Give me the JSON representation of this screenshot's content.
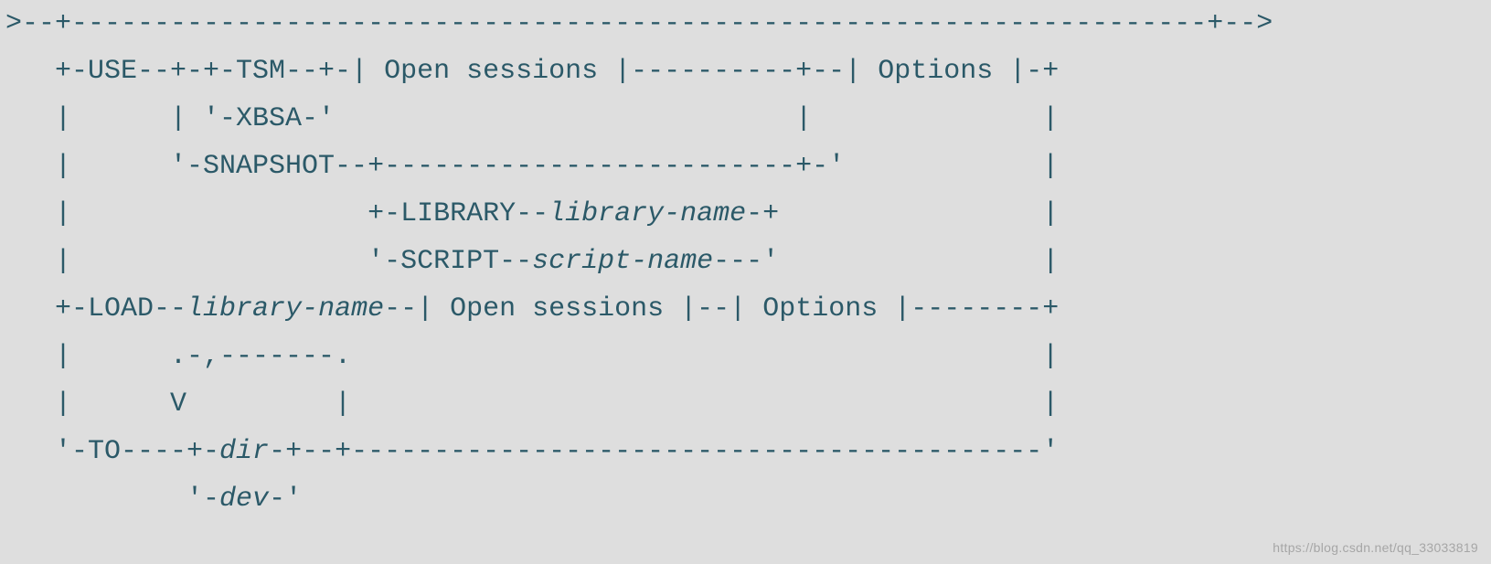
{
  "syntax": {
    "raw_lines": [
      ">--+---------------------------------------------------------------------+-->",
      "   +-USE--+-+-TSM--+-| Open sessions |----------+--| Options |-+",
      "   |      | '-XBSA-'                            |              |",
      "   |      '-SNAPSHOT--+-------------------------+-'            |",
      "   |                  +-LIBRARY--library-name-+                |",
      "   |                  '-SCRIPT--script-name---'                |",
      "   +-LOAD--library-name--| Open sessions |--| Options |--------+",
      "   |      .-,-------.                                          |",
      "   |      V         |                                          |",
      "   '-TO----+-dir-+--+------------------------------------------'",
      "           '-dev-'"
    ],
    "keywords": [
      "USE",
      "TSM",
      "XBSA",
      "SNAPSHOT",
      "LIBRARY",
      "SCRIPT",
      "LOAD",
      "TO"
    ],
    "fragments": [
      "Open sessions",
      "Options"
    ],
    "variables": [
      "library-name",
      "script-name",
      "dir",
      "dev"
    ]
  },
  "watermark": "https://blog.csdn.net/qq_33033819"
}
